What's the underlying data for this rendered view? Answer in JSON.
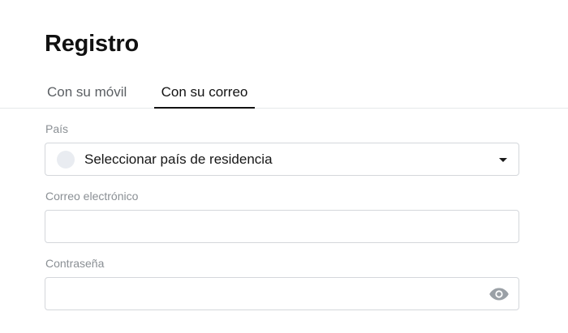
{
  "page": {
    "title": "Registro"
  },
  "tabs": [
    {
      "label": "Con su móvil",
      "active": false
    },
    {
      "label": "Con su correo",
      "active": true
    }
  ],
  "form": {
    "country": {
      "label": "País",
      "value": "Seleccionar país de residencia",
      "icon": "chevron-down-icon"
    },
    "email": {
      "label": "Correo electrónico",
      "value": "",
      "placeholder": ""
    },
    "password": {
      "label": "Contraseña",
      "value": "",
      "placeholder": "",
      "icon": "eye-icon"
    }
  },
  "colors": {
    "text": "#121212",
    "muted_label": "#8a8f94",
    "border": "#d4d7db",
    "icon": "#9aa0a6"
  }
}
